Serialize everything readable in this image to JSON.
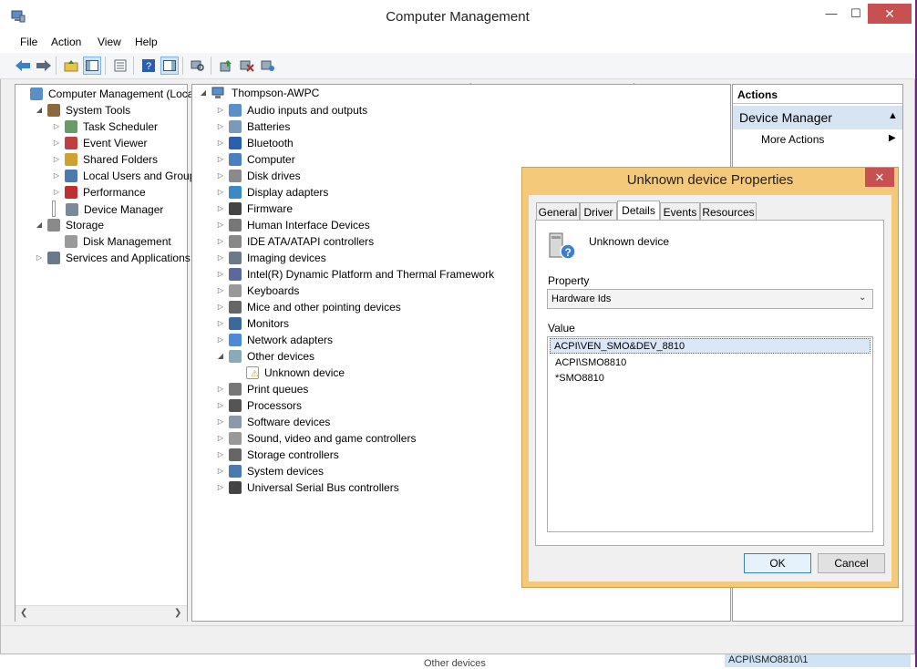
{
  "window": {
    "title": "Computer Management"
  },
  "menu": [
    "File",
    "Action",
    "View",
    "Help"
  ],
  "left_tree": [
    {
      "label": "Computer Management (Local",
      "indent": 0,
      "expander": "",
      "icon": "computer-management-icon"
    },
    {
      "label": "System Tools",
      "indent": 1,
      "expander": "◢",
      "icon": "tools-icon"
    },
    {
      "label": "Task Scheduler",
      "indent": 2,
      "expander": "▷",
      "icon": "clock-icon"
    },
    {
      "label": "Event Viewer",
      "indent": 2,
      "expander": "▷",
      "icon": "event-viewer-icon"
    },
    {
      "label": "Shared Folders",
      "indent": 2,
      "expander": "▷",
      "icon": "shared-folder-icon"
    },
    {
      "label": "Local Users and Groups",
      "indent": 2,
      "expander": "▷",
      "icon": "users-icon"
    },
    {
      "label": "Performance",
      "indent": 2,
      "expander": "▷",
      "icon": "performance-icon"
    },
    {
      "label": "Device Manager",
      "indent": 2,
      "expander": "",
      "icon": "device-manager-icon",
      "selected": true
    },
    {
      "label": "Storage",
      "indent": 1,
      "expander": "◢",
      "icon": "storage-icon"
    },
    {
      "label": "Disk Management",
      "indent": 2,
      "expander": "",
      "icon": "disk-management-icon"
    },
    {
      "label": "Services and Applications",
      "indent": 1,
      "expander": "▷",
      "icon": "services-icon"
    }
  ],
  "device_tree": {
    "root": "Thompson-AWPC",
    "items": [
      {
        "label": "Audio inputs and outputs",
        "icon": "speaker-icon",
        "expander": "▷"
      },
      {
        "label": "Batteries",
        "icon": "battery-icon",
        "expander": "▷"
      },
      {
        "label": "Bluetooth",
        "icon": "bluetooth-icon",
        "expander": "▷"
      },
      {
        "label": "Computer",
        "icon": "computer-icon",
        "expander": "▷"
      },
      {
        "label": "Disk drives",
        "icon": "disk-drive-icon",
        "expander": "▷"
      },
      {
        "label": "Display adapters",
        "icon": "display-adapter-icon",
        "expander": "▷"
      },
      {
        "label": "Firmware",
        "icon": "firmware-icon",
        "expander": "▷"
      },
      {
        "label": "Human Interface Devices",
        "icon": "hid-icon",
        "expander": "▷"
      },
      {
        "label": "IDE ATA/ATAPI controllers",
        "icon": "ide-icon",
        "expander": "▷"
      },
      {
        "label": "Imaging devices",
        "icon": "camera-icon",
        "expander": "▷"
      },
      {
        "label": "Intel(R) Dynamic Platform and Thermal Framework",
        "icon": "thermal-icon",
        "expander": "▷"
      },
      {
        "label": "Keyboards",
        "icon": "keyboard-icon",
        "expander": "▷"
      },
      {
        "label": "Mice and other pointing devices",
        "icon": "mouse-icon",
        "expander": "▷"
      },
      {
        "label": "Monitors",
        "icon": "monitor-icon",
        "expander": "▷"
      },
      {
        "label": "Network adapters",
        "icon": "network-icon",
        "expander": "▷"
      },
      {
        "label": "Other devices",
        "icon": "other-devices-icon",
        "expander": "◢"
      },
      {
        "label": "Unknown device",
        "icon": "unknown-device-warning-icon",
        "expander": "",
        "child": true
      },
      {
        "label": "Print queues",
        "icon": "printer-icon",
        "expander": "▷"
      },
      {
        "label": "Processors",
        "icon": "processor-icon",
        "expander": "▷"
      },
      {
        "label": "Software devices",
        "icon": "software-device-icon",
        "expander": "▷"
      },
      {
        "label": "Sound, video and game controllers",
        "icon": "sound-icon",
        "expander": "▷"
      },
      {
        "label": "Storage controllers",
        "icon": "storage-controller-icon",
        "expander": "▷"
      },
      {
        "label": "System devices",
        "icon": "system-device-icon",
        "expander": "▷"
      },
      {
        "label": "Universal Serial Bus controllers",
        "icon": "usb-icon",
        "expander": "▷"
      }
    ]
  },
  "actions": {
    "header": "Actions",
    "section": "Device Manager",
    "more": "More Actions"
  },
  "dialog": {
    "title": "Unknown device Properties",
    "tabs": [
      "General",
      "Driver",
      "Details",
      "Events",
      "Resources"
    ],
    "selected_tab": "Details",
    "device_name": "Unknown device",
    "property_label": "Property",
    "property_value": "Hardware Ids",
    "value_label": "Value",
    "values": [
      "ACPI\\VEN_SMO&DEV_8810",
      "ACPI\\SMO8810",
      "*SMO8810"
    ],
    "ok": "OK",
    "cancel": "Cancel"
  },
  "background_fragments": {
    "bottom_text": "Other devices",
    "bottom_right_text": "ACPI\\SMO8810\\1"
  },
  "colors": {
    "accent": "#d7e4f2",
    "dialog_frame": "#f4c97a",
    "close": "#c75050"
  }
}
